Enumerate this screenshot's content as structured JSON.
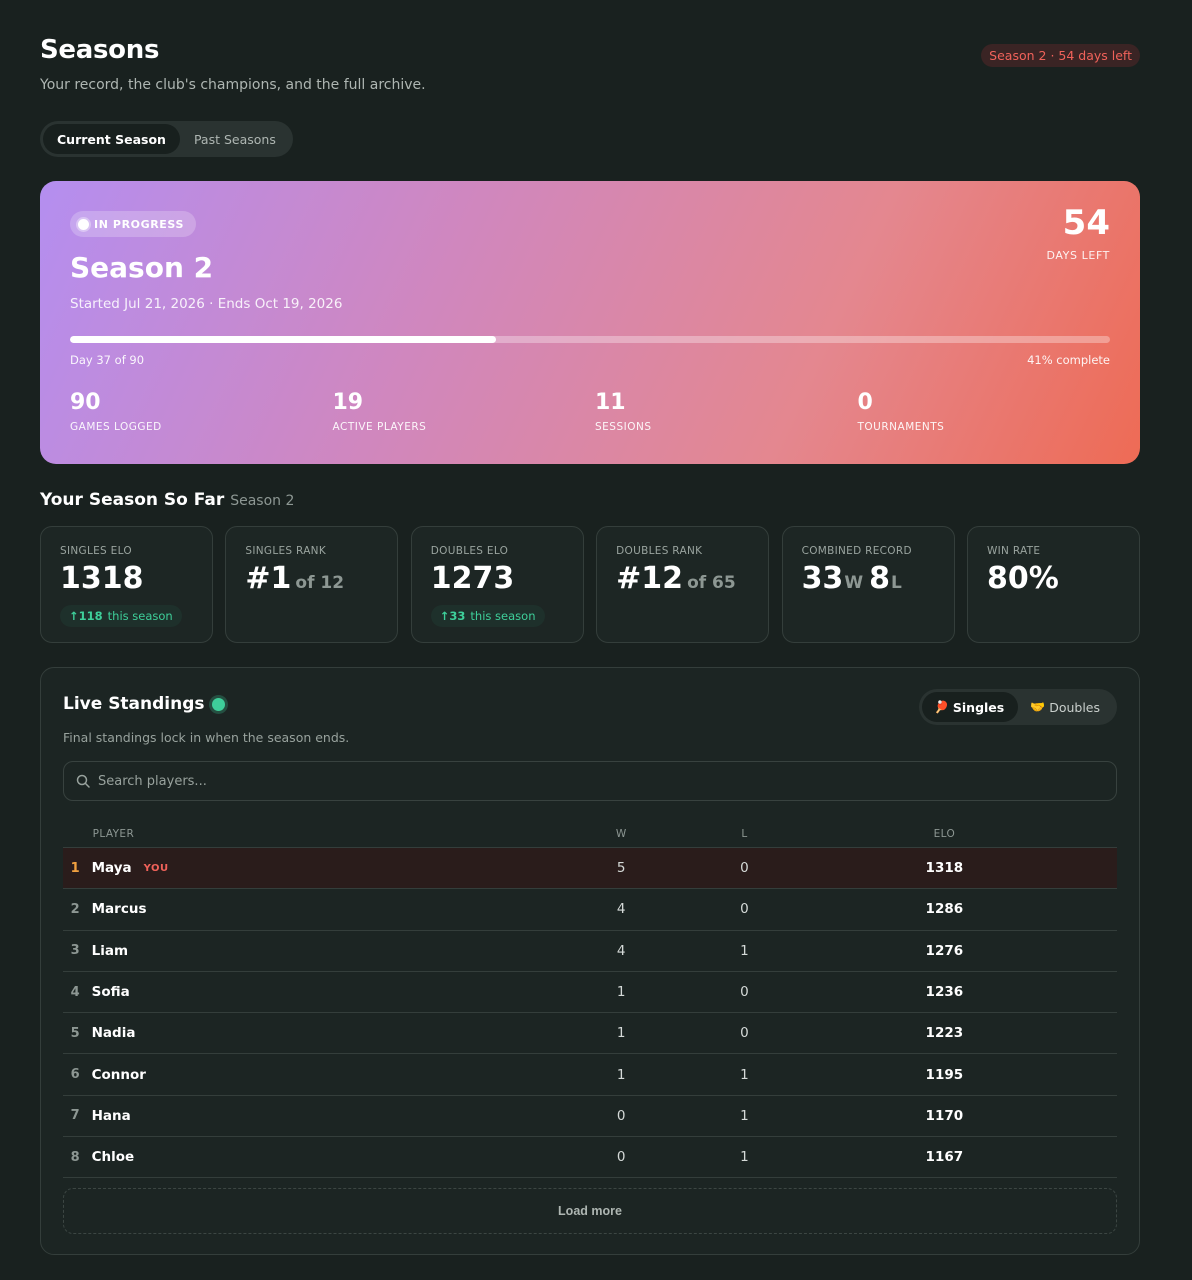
{
  "header": {
    "title": "Seasons",
    "subtitle": "Your record, the club's champions, and the full archive.",
    "season_badge": "Season 2 · 54 days left",
    "tabs": [
      {
        "label": "Current Season",
        "active": true
      },
      {
        "label": "Past Seasons",
        "active": false
      }
    ]
  },
  "hero": {
    "status": "IN PROGRESS",
    "title": "Season 2",
    "dates": "Started Jul 21, 2026 · Ends Oct 19, 2026",
    "days_left_value": "54",
    "days_left_label": "DAYS LEFT",
    "progress_percent": 41,
    "progress_left": "Day 37 of 90",
    "progress_right": "41% complete",
    "stats": [
      {
        "value": "90",
        "label": "GAMES LOGGED"
      },
      {
        "value": "19",
        "label": "ACTIVE PLAYERS"
      },
      {
        "value": "11",
        "label": "SESSIONS"
      },
      {
        "value": "0",
        "label": "TOURNAMENTS"
      }
    ],
    "colors": {
      "gradient_start": "#b48ef0",
      "gradient_end": "#ee6b55"
    }
  },
  "season_so_far": {
    "title": "Your Season So Far",
    "subtitle": "Season 2",
    "cards": {
      "singles_elo": {
        "label": "SINGLES ELO",
        "value": "1318",
        "delta_value": "↑118",
        "delta_text": "this season"
      },
      "singles_rank": {
        "label": "SINGLES RANK",
        "value": "#1",
        "of": "of 12"
      },
      "doubles_elo": {
        "label": "DOUBLES ELO",
        "value": "1273",
        "delta_value": "↑33",
        "delta_text": "this season"
      },
      "doubles_rank": {
        "label": "DOUBLES RANK",
        "value": "#12",
        "of": "of 65"
      },
      "combined_record": {
        "label": "COMBINED RECORD",
        "wins": "33",
        "wins_unit": "W",
        "losses": "8",
        "losses_unit": "L"
      },
      "win_rate": {
        "label": "WIN RATE",
        "value": "80%"
      }
    }
  },
  "standings": {
    "title": "Live Standings",
    "subtitle": "Final standings lock in when the season ends.",
    "toggle": [
      {
        "label": "Singles",
        "icon": "ping-pong-paddle-icon",
        "emoji": "🏓",
        "active": true
      },
      {
        "label": "Doubles",
        "icon": "handshake-icon",
        "emoji": "🤝",
        "active": false
      }
    ],
    "search_placeholder": "Search players...",
    "columns": {
      "player": "PLAYER",
      "w": "W",
      "l": "L",
      "elo": "ELO"
    },
    "you_tag": "YOU",
    "rows": [
      {
        "rank": "1",
        "name": "Maya",
        "w": "5",
        "l": "0",
        "elo": "1318",
        "you": true
      },
      {
        "rank": "2",
        "name": "Marcus",
        "w": "4",
        "l": "0",
        "elo": "1286",
        "you": false
      },
      {
        "rank": "3",
        "name": "Liam",
        "w": "4",
        "l": "1",
        "elo": "1276",
        "you": false
      },
      {
        "rank": "4",
        "name": "Sofia",
        "w": "1",
        "l": "0",
        "elo": "1236",
        "you": false
      },
      {
        "rank": "5",
        "name": "Nadia",
        "w": "1",
        "l": "0",
        "elo": "1223",
        "you": false
      },
      {
        "rank": "6",
        "name": "Connor",
        "w": "1",
        "l": "1",
        "elo": "1195",
        "you": false
      },
      {
        "rank": "7",
        "name": "Hana",
        "w": "0",
        "l": "1",
        "elo": "1170",
        "you": false
      },
      {
        "rank": "8",
        "name": "Chloe",
        "w": "0",
        "l": "1",
        "elo": "1167",
        "you": false
      }
    ],
    "load_more": "Load more"
  }
}
